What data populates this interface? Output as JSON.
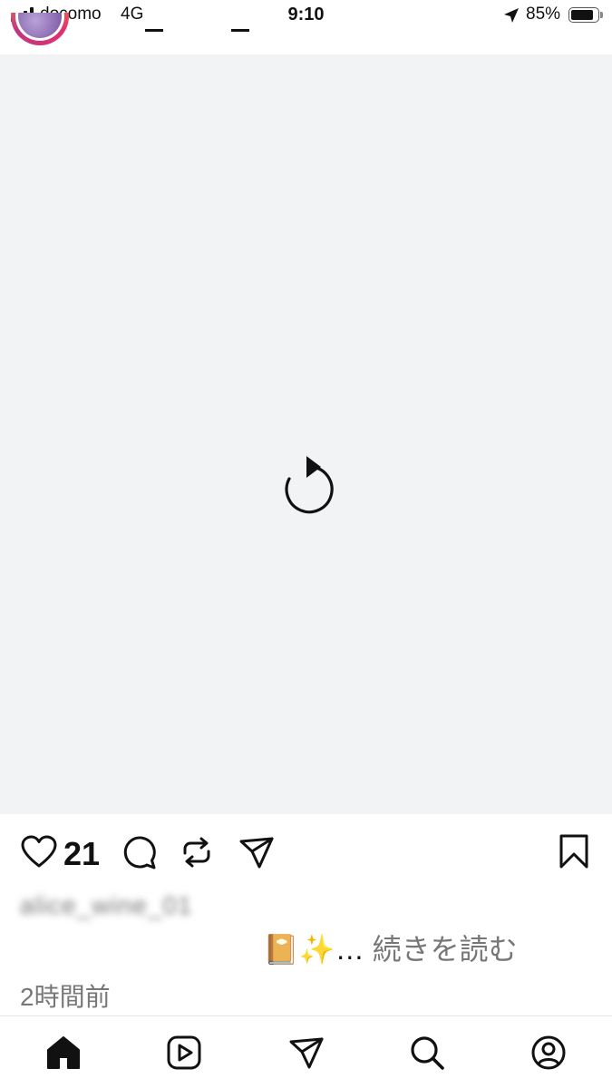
{
  "status_bar": {
    "carrier": "docomo",
    "network": "4G",
    "time": "9:10",
    "battery_percent": "85%",
    "battery_level": 0.85,
    "icons": [
      "signal-bars-icon",
      "location-arrow-icon",
      "battery-icon"
    ]
  },
  "post": {
    "media_state_icon": "reload-icon",
    "like_count": "21",
    "username": "alice_wine_01",
    "caption_emoji": "📔✨",
    "caption_ellipsis": "…",
    "read_more": "続きを読む",
    "timestamp": "2時間前",
    "action_icons": [
      "heart-icon",
      "comment-icon",
      "repost-icon",
      "send-icon",
      "bookmark-icon"
    ]
  },
  "bottom_nav": {
    "items": [
      "home-icon",
      "reels-icon",
      "direct-messages-icon",
      "search-icon",
      "profile-icon"
    ],
    "active": "home-icon"
  },
  "colors": {
    "media_placeholder": "#f2f3f5",
    "text_primary": "#111111",
    "text_secondary": "#777777"
  }
}
